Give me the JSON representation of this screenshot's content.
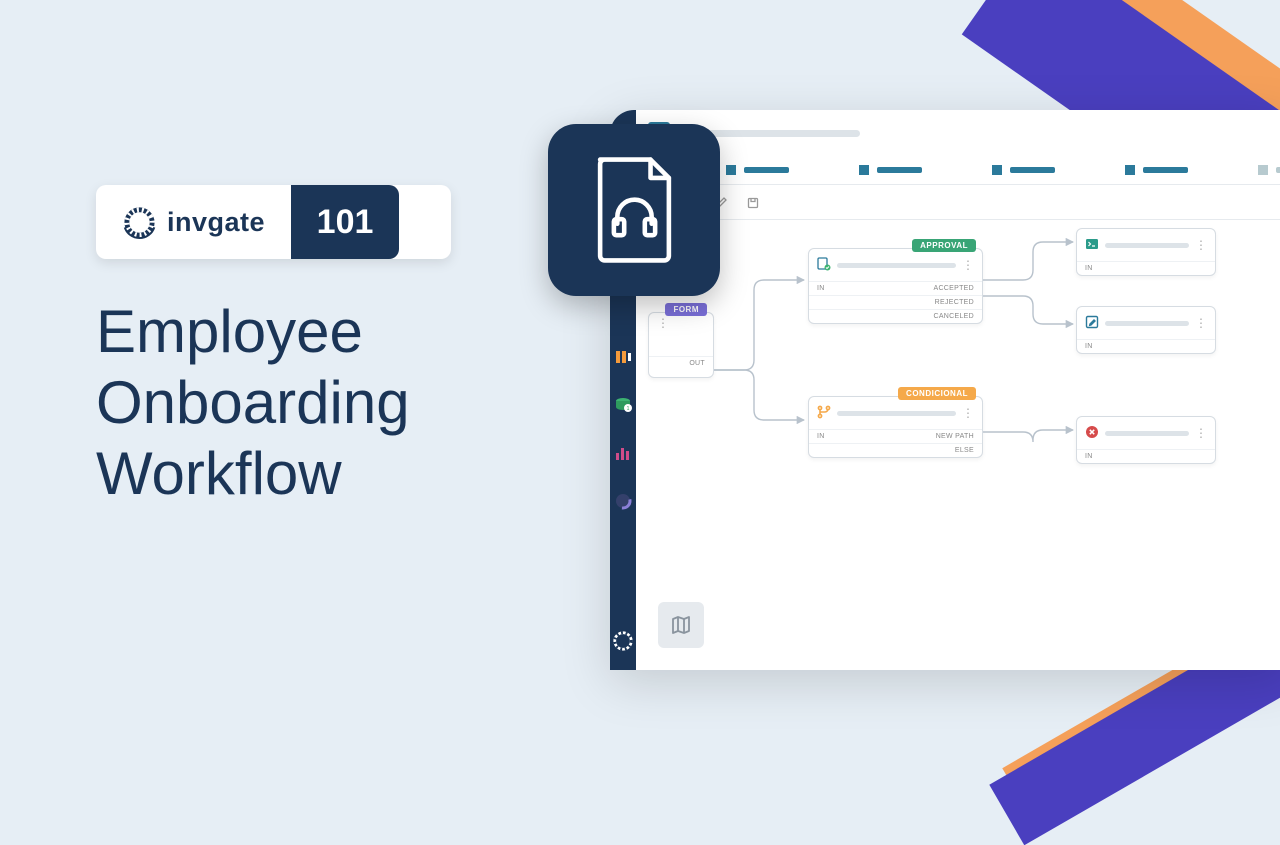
{
  "brand": {
    "name": "invgate",
    "course_badge": "101",
    "accent": "#1B3557"
  },
  "headline": {
    "line1": "Employee",
    "line2": "Onboarding",
    "line3": "Workflow"
  },
  "workflow": {
    "nodes": {
      "form": {
        "tag": "FORM",
        "out_label": "OUT"
      },
      "approval": {
        "tag": "APPROVAL",
        "in_label": "IN",
        "paths": [
          "ACCEPTED",
          "REJECTED",
          "CANCELED"
        ]
      },
      "conditional": {
        "tag": "CONDICIONAL",
        "in_label": "IN",
        "paths": [
          "NEW PATH",
          "ELSE"
        ]
      },
      "task_a": {
        "in_label": "IN"
      },
      "task_b": {
        "in_label": "IN"
      },
      "error": {
        "in_label": "IN"
      }
    }
  }
}
